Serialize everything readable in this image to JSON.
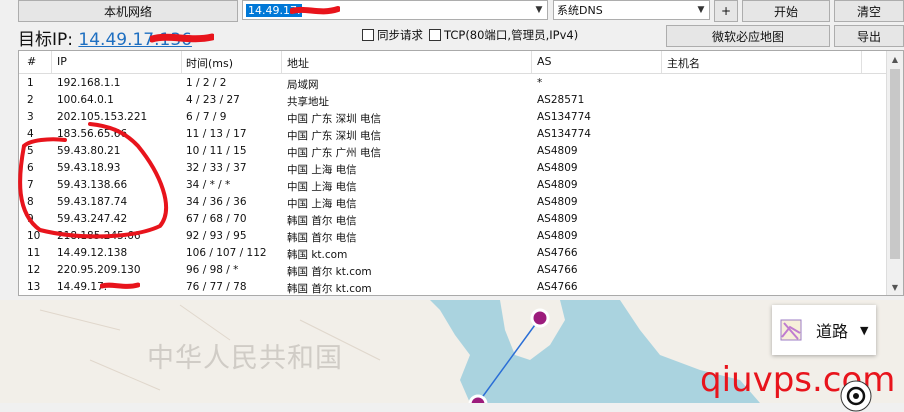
{
  "toolbar": {
    "local_network_btn": "本机网络",
    "target_value": "14.49.17.",
    "dns_value": "系统DNS",
    "add_btn": "+",
    "start_btn": "开始",
    "clear_btn": "清空",
    "map_btn": "微软必应地图",
    "export_btn": "导出"
  },
  "target": {
    "label": "目标IP:",
    "ip": "14.49.17.136"
  },
  "options": {
    "sync_label": "同步请求",
    "tcp_label": "TCP(80端口,管理员,IPv4)"
  },
  "table": {
    "headers": [
      "#",
      "IP",
      "时间(ms)",
      "地址",
      "AS",
      "主机名"
    ],
    "rows": [
      [
        "1",
        "192.168.1.1",
        "1 / 2 / 2",
        "局域网",
        "*",
        ""
      ],
      [
        "2",
        "100.64.0.1",
        "4 / 23 / 27",
        "共享地址",
        "AS28571",
        ""
      ],
      [
        "3",
        "202.105.153.221",
        "6 / 7 / 9",
        "中国 广东 深圳 电信",
        "AS134774",
        ""
      ],
      [
        "4",
        "183.56.65.66",
        "11 / 13 / 17",
        "中国 广东 深圳 电信",
        "AS134774",
        ""
      ],
      [
        "5",
        "59.43.80.21",
        "10 / 11 / 15",
        "中国 广东 广州 电信",
        "AS4809",
        ""
      ],
      [
        "6",
        "59.43.18.93",
        "32 / 33 / 37",
        "中国 上海 电信",
        "AS4809",
        ""
      ],
      [
        "7",
        "59.43.138.66",
        "34 / * / *",
        "中国 上海 电信",
        "AS4809",
        ""
      ],
      [
        "8",
        "59.43.187.74",
        "34 / 36 / 36",
        "中国 上海 电信",
        "AS4809",
        ""
      ],
      [
        "9",
        "59.43.247.42",
        "67 / 68 / 70",
        "韩国 首尔 电信",
        "AS4809",
        ""
      ],
      [
        "10",
        "218.185.245.66",
        "92 / 93 / 95",
        "韩国 首尔 电信",
        "AS4809",
        ""
      ],
      [
        "11",
        "14.49.12.138",
        "106 / 107 / 112",
        "韩国 kt.com",
        "AS4766",
        ""
      ],
      [
        "12",
        "220.95.209.130",
        "96 / 98 / *",
        "韩国 首尔 kt.com",
        "AS4766",
        ""
      ],
      [
        "13",
        "14.49.17.",
        "76 / 77 / 78",
        "韩国 首尔 kt.com",
        "AS4766",
        ""
      ]
    ]
  },
  "map": {
    "watermark": "中华人民共和国",
    "layer_label": "道路"
  },
  "site_mark": "qiuvps.com",
  "colors": {
    "accent": "#1e6fc1",
    "annotation": "#e8141c",
    "marker": "#9c1c7c"
  }
}
